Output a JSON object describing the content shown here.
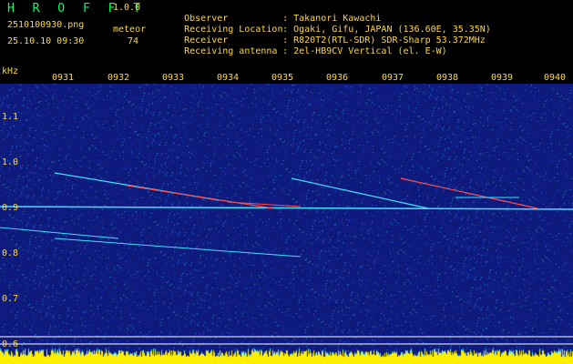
{
  "header": {
    "app_name": "HROFFT",
    "version": "1.0.0",
    "filename": "2510100930.png",
    "datetime": "25.10.10 09:30",
    "meteor_label": "meteor",
    "meteor_count": "74",
    "info": [
      {
        "key": "Observer",
        "value": "Takanori Kawachi"
      },
      {
        "key": "Receiving Location",
        "value": "Ogaki, Gifu, JAPAN (136.60E, 35.35N)"
      },
      {
        "key": "Receiver",
        "value": "R820T2(RTL-SDR) SDR-Sharp 53.372MHz"
      },
      {
        "key": "Receiving antenna",
        "value": "2el-HB9CV Vertical (el. E-W)"
      }
    ]
  },
  "axes": {
    "y_unit": "kHz",
    "y_ticks": [
      "1.1",
      "1.0",
      "0.9",
      "0.8",
      "0.7",
      "0.6"
    ],
    "x_ticks": [
      "0931",
      "0932",
      "0933",
      "0934",
      "0935",
      "0936",
      "0937",
      "0938",
      "0939",
      "0940"
    ]
  },
  "colors": {
    "background": "#000000",
    "label_text": "#ffd83a",
    "app_title": "#00ff66",
    "spectrogram_base": "#10207a",
    "trace_cyan": "#40e0ff",
    "trace_hot": "#ff5050",
    "bottom_bar": "#ffee00"
  }
}
